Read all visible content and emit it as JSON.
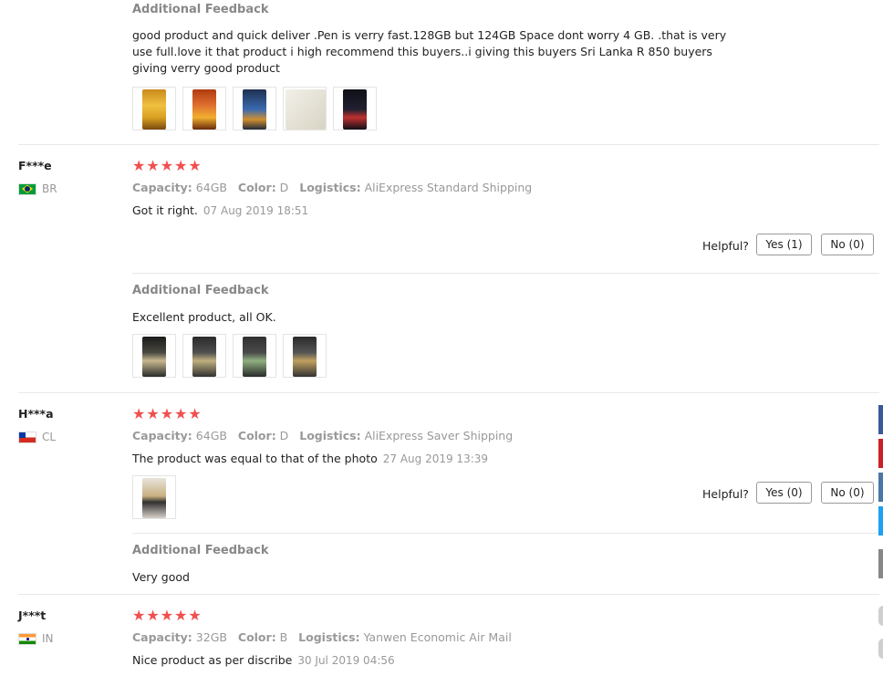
{
  "labels": {
    "additional_feedback": "Additional Feedback",
    "capacity": "Capacity:",
    "color": "Color:",
    "logistics": "Logistics:",
    "helpful": "Helpful?"
  },
  "top_feedback": {
    "text": "good product and quick deliver .Pen is verry fast.128GB but 124GB Space dont worry 4 GB. .that is very use full.love it that product i high recommend this buyers..i giving this buyers Sri Lanka R 850 buyers giving verry good product"
  },
  "reviews": [
    {
      "user": "F***e",
      "country": "BR",
      "stars": "★★★★★",
      "capacity": "64GB",
      "color": "D",
      "logistics": "AliExpress Standard Shipping",
      "text": "Got it right.",
      "date": "07 Aug 2019 18:51",
      "yes": "Yes (1)",
      "no": "No (0)",
      "additional": "Excellent product, all OK."
    },
    {
      "user": "H***a",
      "country": "CL",
      "stars": "★★★★★",
      "capacity": "64GB",
      "color": "D",
      "logistics": "AliExpress Saver Shipping",
      "text": "The product was equal to that of the photo",
      "date": "27 Aug 2019 13:39",
      "yes": "Yes (0)",
      "no": "No (0)",
      "additional": "Very good"
    },
    {
      "user": "J***t",
      "country": "IN",
      "stars": "★★★★★",
      "capacity": "32GB",
      "color": "B",
      "logistics": "Yanwen Economic Air Mail",
      "text": "Nice product as per discribe",
      "date": "30 Jul 2019 04:56"
    }
  ],
  "colors": {
    "star": "#f0504f",
    "side_tabs": [
      "#3b5998",
      "#cb2027",
      "#4a76a8",
      "#1da1f2",
      "#888888"
    ]
  }
}
